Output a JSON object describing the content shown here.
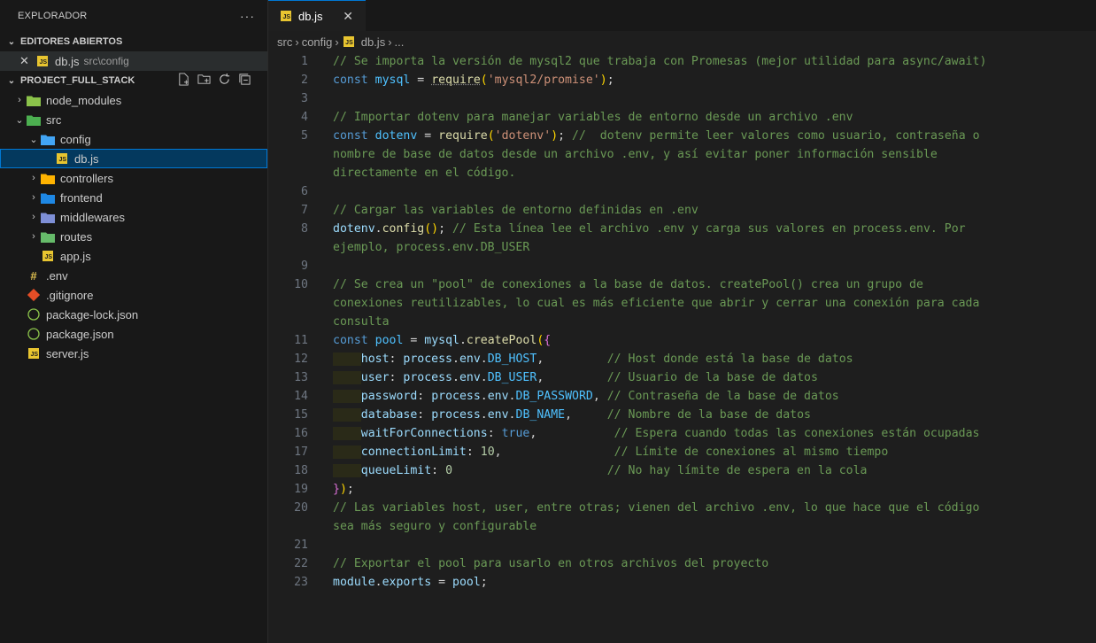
{
  "sidebar": {
    "title": "EXPLORADOR",
    "more": "···",
    "open_editors": {
      "header": "EDITORES ABIERTOS",
      "items": [
        {
          "name": "db.js",
          "path": "src\\config"
        }
      ]
    },
    "project": {
      "header": "PROJECT_FULL_STACK",
      "tree": [
        {
          "label": "node_modules",
          "icon": "folder-node-icon",
          "depth": 0,
          "chevron": "›"
        },
        {
          "label": "src",
          "icon": "folder-src-icon",
          "depth": 0,
          "chevron": "⌄"
        },
        {
          "label": "config",
          "icon": "folder-config-icon",
          "depth": 1,
          "chevron": "⌄"
        },
        {
          "label": "db.js",
          "icon": "js-file-icon",
          "depth": 2,
          "chevron": ""
        },
        {
          "label": "controllers",
          "icon": "folder-controllers-icon",
          "depth": 1,
          "chevron": "›"
        },
        {
          "label": "frontend",
          "icon": "folder-frontend-icon",
          "depth": 1,
          "chevron": "›"
        },
        {
          "label": "middlewares",
          "icon": "folder-middlewares-icon",
          "depth": 1,
          "chevron": "›"
        },
        {
          "label": "routes",
          "icon": "folder-routes-icon",
          "depth": 1,
          "chevron": "›"
        },
        {
          "label": "app.js",
          "icon": "js-file-icon",
          "depth": 1,
          "chevron": ""
        },
        {
          "label": ".env",
          "icon": "env-file-icon",
          "depth": 0,
          "chevron": ""
        },
        {
          "label": ".gitignore",
          "icon": "git-file-icon",
          "depth": 0,
          "chevron": ""
        },
        {
          "label": "package-lock.json",
          "icon": "npm-file-icon",
          "depth": 0,
          "chevron": ""
        },
        {
          "label": "package.json",
          "icon": "npm-file-icon",
          "depth": 0,
          "chevron": ""
        },
        {
          "label": "server.js",
          "icon": "js-file-icon",
          "depth": 0,
          "chevron": ""
        }
      ]
    }
  },
  "tab": {
    "label": "db.js",
    "close": "✕"
  },
  "breadcrumb": [
    "src",
    "config",
    "db.js",
    "..."
  ],
  "code_lines": [
    {
      "num": "1",
      "html": "<span class='c'>// Se importa la versión de mysql2 que trabaja con Promesas (mejor utilidad para async/await)</span>"
    },
    {
      "num": "2",
      "html": "<span class='k'>const</span> <span class='cs'>mysql</span> = <span class='f u'>require</span><span class='p'>(</span><span class='s'>'mysql2/promise'</span><span class='p'>)</span>;"
    },
    {
      "num": "3",
      "html": ""
    },
    {
      "num": "4",
      "html": "<span class='c'>// Importar dotenv para manejar variables de entorno desde un archivo .env</span>"
    },
    {
      "num": "5",
      "html": "<span class='k'>const</span> <span class='cs'>dotenv</span> = <span class='f'>require</span><span class='p'>(</span><span class='s'>'dotenv'</span><span class='p'>)</span>; <span class='c'>//  dotenv permite leer valores como usuario, contraseña o</span>"
    },
    {
      "num": "",
      "html": "<span class='c'>nombre de base de datos desde un archivo .env, y así evitar poner información sensible</span>"
    },
    {
      "num": "",
      "html": "<span class='c'>directamente en el código.</span>"
    },
    {
      "num": "6",
      "html": ""
    },
    {
      "num": "7",
      "html": "<span class='c'>// Cargar las variables de entorno definidas en .env</span>"
    },
    {
      "num": "8",
      "html": "<span class='v'>dotenv</span>.<span class='f'>config</span><span class='p'>()</span>; <span class='c'>// Esta línea lee el archivo .env y carga sus valores en process.env. Por</span>"
    },
    {
      "num": "",
      "html": "<span class='c'>ejemplo, process.env.DB_USER</span>"
    },
    {
      "num": "9",
      "html": ""
    },
    {
      "num": "10",
      "html": "<span class='c'>// Se crea un \"pool\" de conexiones a la base de datos. createPool() crea un grupo de</span>"
    },
    {
      "num": "",
      "html": "<span class='c'>conexiones reutilizables, lo cual es más eficiente que abrir y cerrar una conexión para cada</span>"
    },
    {
      "num": "",
      "html": "<span class='c'>consulta</span>"
    },
    {
      "num": "11",
      "html": "<span class='k'>const</span> <span class='cs'>pool</span> = <span class='v'>mysql</span>.<span class='f'>createPool</span><span class='p'>(</span><span class='p2'>{</span>"
    },
    {
      "num": "12",
      "html": "<span class='indent-guide'>    </span><span class='v'>host</span>: <span class='v'>process</span>.<span class='v'>env</span>.<span class='cs'>DB_HOST</span>,         <span class='c'>// Host donde está la base de datos</span>"
    },
    {
      "num": "13",
      "html": "<span class='indent-guide'>    </span><span class='v'>user</span>: <span class='v'>process</span>.<span class='v'>env</span>.<span class='cs'>DB_USER</span>,         <span class='c'>// Usuario de la base de datos</span>"
    },
    {
      "num": "14",
      "html": "<span class='indent-guide'>    </span><span class='v'>password</span>: <span class='v'>process</span>.<span class='v'>env</span>.<span class='cs'>DB_PASSWORD</span>, <span class='c'>// Contraseña de la base de datos</span>"
    },
    {
      "num": "15",
      "html": "<span class='indent-guide'>    </span><span class='v'>database</span>: <span class='v'>process</span>.<span class='v'>env</span>.<span class='cs'>DB_NAME</span>,     <span class='c'>// Nombre de la base de datos</span>"
    },
    {
      "num": "16",
      "html": "<span class='indent-guide'>    </span><span class='v'>waitForConnections</span>: <span class='k'>true</span>,           <span class='c'>// Espera cuando todas las conexiones están ocupadas</span>"
    },
    {
      "num": "17",
      "html": "<span class='indent-guide'>    </span><span class='v'>connectionLimit</span>: <span class='n'>10</span>,                <span class='c'>// Límite de conexiones al mismo tiempo</span>"
    },
    {
      "num": "18",
      "html": "<span class='indent-guide'>    </span><span class='v'>queueLimit</span>: <span class='n'>0</span>                      <span class='c'>// No hay límite de espera en la cola</span>"
    },
    {
      "num": "19",
      "html": "<span class='p2'>}</span><span class='p'>)</span>;"
    },
    {
      "num": "20",
      "html": "<span class='c'>// Las variables host, user, entre otras; vienen del archivo .env, lo que hace que el código</span>"
    },
    {
      "num": "",
      "html": "<span class='c'>sea más seguro y configurable</span>"
    },
    {
      "num": "21",
      "html": ""
    },
    {
      "num": "22",
      "html": "<span class='c'>// Exportar el pool para usarlo en otros archivos del proyecto</span>"
    },
    {
      "num": "23",
      "html": "<span class='v'>module</span>.<span class='v'>exports</span> = <span class='v'>pool</span>;"
    }
  ]
}
